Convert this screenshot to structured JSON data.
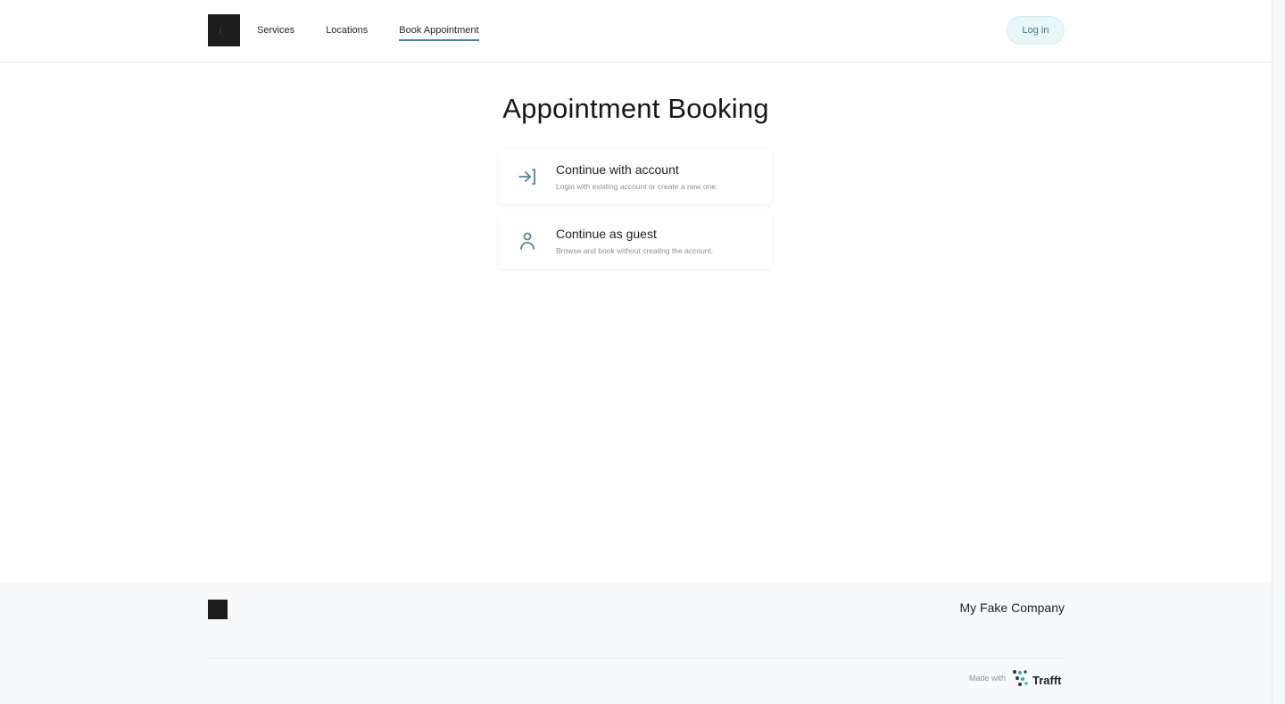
{
  "header": {
    "nav": [
      {
        "label": "Services"
      },
      {
        "label": "Locations"
      },
      {
        "label": "Book Appointment"
      }
    ],
    "login_label": "Log in"
  },
  "main": {
    "title": "Appointment Booking",
    "options": [
      {
        "title": "Continue with account",
        "subtitle": "Login with existing account or create a new one.",
        "icon": "login-arrow-icon"
      },
      {
        "title": "Continue as guest",
        "subtitle": "Browse and book without creating the account.",
        "icon": "user-icon"
      }
    ]
  },
  "footer": {
    "company": "My Fake Company",
    "made_with": "Made with",
    "brand": "Trafft"
  },
  "colors": {
    "accent": "#4f8394",
    "login_bg": "#e9f6f7",
    "footer_bg": "#f8f9fa"
  }
}
